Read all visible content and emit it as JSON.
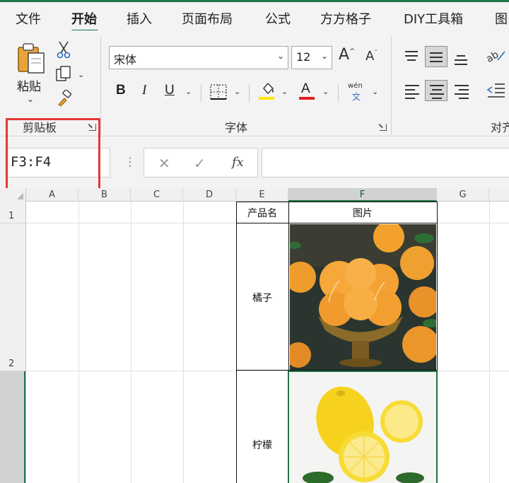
{
  "tabs": [
    "文件",
    "开始",
    "插入",
    "页面布局",
    "公式",
    "方方格子",
    "DIY工具箱",
    "图"
  ],
  "active_tab": "开始",
  "ribbon": {
    "paste_label": "粘贴",
    "clipboard_group": "剪贴板",
    "font_group": "字体",
    "align_group": "对齐",
    "font_name": "宋体",
    "font_size": "12",
    "bold": "B",
    "italic": "I",
    "underline": "U",
    "font_color_letter": "A",
    "grow_font": "A",
    "shrink_font": "A",
    "phonetic_top": "wén",
    "phonetic_bottom": "文",
    "highlight_color": "#ffe600",
    "font_color": "#e41e1e"
  },
  "formula_bar": {
    "name_box": "F3:F4",
    "function_symbol": "fx",
    "formula": ""
  },
  "grid": {
    "columns": [
      "A",
      "B",
      "C",
      "D",
      "E",
      "F",
      "G"
    ],
    "rows": [
      "1",
      "2"
    ],
    "selected_column": "F",
    "header_product": "产品名",
    "header_image": "图片",
    "product_1": "橘子",
    "product_2": "柠檬"
  },
  "colors": {
    "accent": "#217346",
    "highlight_box": "#e43a36"
  }
}
